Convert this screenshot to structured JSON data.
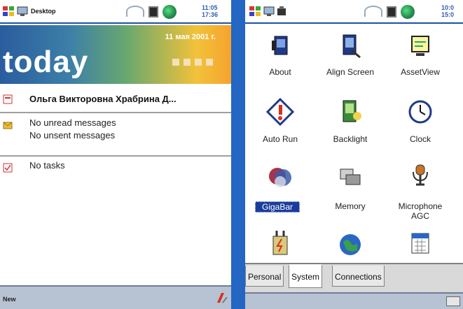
{
  "left_device": {
    "title_bar": {
      "title": "Desktop",
      "clock": [
        "11:05",
        "17:36"
      ]
    },
    "banner": {
      "date": "11 мая 2001 г.",
      "word": "today"
    },
    "owner": {
      "name": "Ольга Викторовна Храбрина Д..."
    },
    "messages": {
      "unread": "No unread messages",
      "unsent": "No unsent messages"
    },
    "tasks": {
      "text": "No tasks"
    },
    "bottom_bar": {
      "new_label": "New"
    }
  },
  "right_device": {
    "title_bar": {
      "clock": [
        "10:0",
        "15:0"
      ]
    },
    "settings_items": [
      {
        "label": "About",
        "icon": "about-icon"
      },
      {
        "label": "Align Screen",
        "icon": "align-screen-icon"
      },
      {
        "label": "AssetView",
        "icon": "assetview-icon"
      },
      {
        "label": "Auto Run",
        "icon": "autorun-icon"
      },
      {
        "label": "Backlight",
        "icon": "backlight-icon"
      },
      {
        "label": "Clock",
        "icon": "clock-icon"
      },
      {
        "label": "GigaBar",
        "icon": "gigabar-icon",
        "selected": true
      },
      {
        "label": "Memory",
        "icon": "memory-icon"
      },
      {
        "label": "Microphone AGC",
        "icon": "microphone-icon"
      },
      {
        "label": "",
        "icon": "power-icon"
      },
      {
        "label": "",
        "icon": "regional-icon"
      },
      {
        "label": "",
        "icon": "calendar-icon"
      }
    ],
    "tabs": [
      "Personal",
      "System",
      "Connections"
    ],
    "active_tab": "System"
  },
  "colors": {
    "frame_blue": "#1c58b6",
    "titlebar_blue": "#2f5db3",
    "selection": "#1b3c9c",
    "banner_orange": "#f6a32e"
  }
}
